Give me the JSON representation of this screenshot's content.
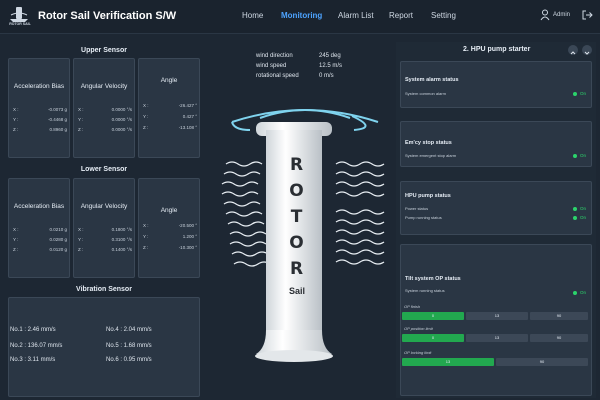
{
  "header": {
    "logo_text": "ROTOR SAIL",
    "title": "Rotor Sail Verification S/W",
    "nav": [
      "Home",
      "Monitoring",
      "Alarm List",
      "Report",
      "Setting"
    ],
    "active_nav": "Monitoring",
    "user_label": "Admin"
  },
  "upper_sensor": {
    "title": "Upper Sensor",
    "cards": [
      {
        "title": "Acceleration Bias",
        "rows": [
          {
            "label": "X :",
            "value": "-0.0073 g"
          },
          {
            "label": "Y :",
            "value": "-0.4468 g"
          },
          {
            "label": "Z :",
            "value": "0.8960 g"
          }
        ]
      },
      {
        "title": "Angular Velocity",
        "rows": [
          {
            "label": "X :",
            "value": "0.0000 °/s"
          },
          {
            "label": "Y :",
            "value": "0.0000 °/s"
          },
          {
            "label": "Z :",
            "value": "0.0000 °/s"
          }
        ]
      },
      {
        "title": "Angle",
        "rows": [
          {
            "label": "X :",
            "value": "-26.427 °"
          },
          {
            "label": "Y :",
            "value": "0.427 °"
          },
          {
            "label": "Z :",
            "value": "-13.108 °"
          }
        ]
      }
    ]
  },
  "lower_sensor": {
    "title": "Lower Sensor",
    "cards": [
      {
        "title": "Acceleration Bias",
        "rows": [
          {
            "label": "X :",
            "value": "0.0210 g"
          },
          {
            "label": "Y :",
            "value": "0.0280 g"
          },
          {
            "label": "Z :",
            "value": "0.0120 g"
          }
        ]
      },
      {
        "title": "Angular Velocity",
        "rows": [
          {
            "label": "X :",
            "value": "0.1800 °/s"
          },
          {
            "label": "Y :",
            "value": "0.3100 °/s"
          },
          {
            "label": "Z :",
            "value": "0.1400 °/s"
          }
        ]
      },
      {
        "title": "Angle",
        "rows": [
          {
            "label": "X :",
            "value": "-20.500 °"
          },
          {
            "label": "Y :",
            "value": "1.200 °"
          },
          {
            "label": "Z :",
            "value": "-10.300 °"
          }
        ]
      }
    ]
  },
  "vibration": {
    "title": "Vibration Sensor",
    "items": [
      "No.1 : 2.46 mm/s",
      "No.2 : 136.07 mm/s",
      "No.3 : 3.11 mm/s",
      "No.4 : 2.04 mm/s",
      "No.5 : 1.68 mm/s",
      "No.6 : 0.95 mm/s"
    ]
  },
  "wind": {
    "rows": [
      {
        "label": "wind direction",
        "value": "245 deg"
      },
      {
        "label": "wind speed",
        "value": "12.5 m/s"
      },
      {
        "label": "rotational speed",
        "value": "0 m/s"
      }
    ]
  },
  "rotor": {
    "letters": [
      "R",
      "O",
      "T",
      "O",
      "R"
    ],
    "sail_text": "Sail"
  },
  "hpu": {
    "title": "2. HPU pump starter",
    "system_alarm": {
      "title": "System alarm status",
      "rows": [
        {
          "label": "System common alarm",
          "status": "On"
        }
      ]
    },
    "emcy_stop": {
      "title": "Em'cy stop status",
      "rows": [
        {
          "label": "System emergent stop alarm",
          "status": "On"
        }
      ]
    },
    "hpu_pump": {
      "title": "HPU pump status",
      "rows": [
        {
          "label": "Power status",
          "status": "On"
        },
        {
          "label": "Pump running status",
          "status": "On"
        }
      ]
    },
    "tilt": {
      "title": "Tilt system OP status",
      "rows": [
        {
          "label": "System running status",
          "status": "On"
        }
      ],
      "op_finish": {
        "label": "OP finish",
        "values": [
          "0",
          "13",
          "90"
        ]
      },
      "op_position": {
        "label": "OP position limit",
        "values": [
          "0",
          "13",
          "90"
        ]
      },
      "op_locking": {
        "label": "OP locking limit",
        "values": [
          "13",
          "90"
        ]
      }
    }
  },
  "colors": {
    "accent": "#4da3ff",
    "on": "#2bd46b",
    "bar_active": "#22a84f",
    "background": "#1d2733"
  },
  "icons": [
    "user-icon",
    "logout-icon",
    "chevron-up-icon",
    "chevron-down-icon"
  ]
}
